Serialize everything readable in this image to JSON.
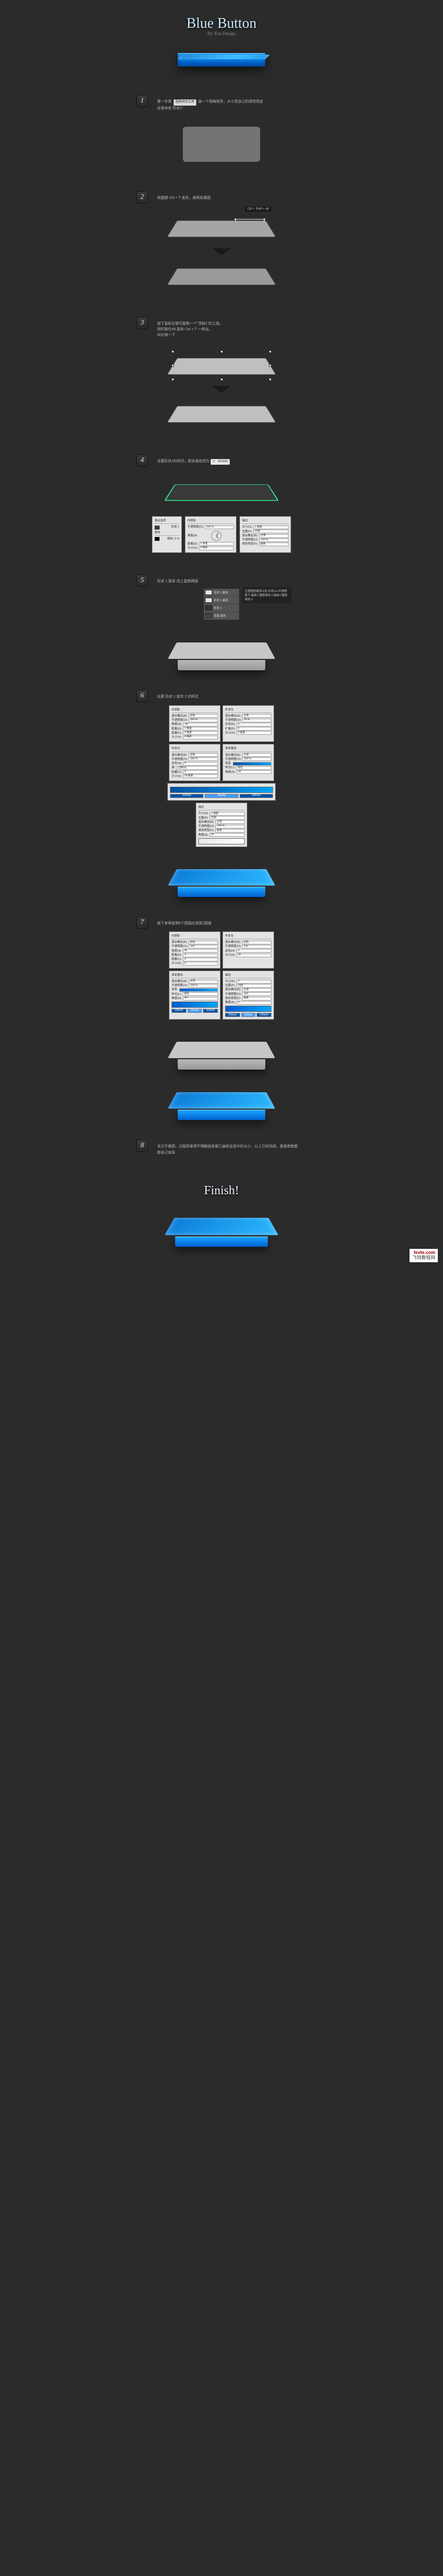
{
  "header": {
    "title": "Blue Button",
    "subtitle": "By You Design"
  },
  "steps": {
    "s1": {
      "num": "1",
      "line1_a": "第一步用",
      "tool_chip": "圆角矩形工具",
      "line1_b": "画一个圆角矩形，大小凭自己的感觉而定",
      "line2": "这里命名\"形状1\""
    },
    "s2": {
      "num": "2",
      "text": "快捷键 Ctrl + T 变形，按照效果图",
      "drag_hint": "Ctrl + Shift + Alt"
    },
    "s3": {
      "num": "3",
      "line1": "按下鼠标左键可复制一个\"顶部1\"的上面，",
      "line2": "同时按住Alt 副本 Ctrl + T 一样向，",
      "line3": "向右缩一下"
    },
    "s4": {
      "num": "4",
      "text_a": "设置形状1的样式，颜色填色改为",
      "hex": "#：393939",
      "dlg_inner": {
        "hdr": "内阴影",
        "blend": "不透明度(O):",
        "v100": "100 %",
        "angle": "角度(A):",
        "d": "距离(D):",
        "v0": "0 像素",
        "size": "大小(S):",
        "v5": "5 像素"
      },
      "dlg_stroke": {
        "hdr": "描边",
        "size": "大小(S):",
        "v1": "1 像素",
        "pos": "位置(P):",
        "outside": "外部",
        "blend": "混合模式(B):",
        "normal": "正常",
        "opacity": "不透明度(O):",
        "fill": "填充类型(F):",
        "color": "颜色"
      },
      "dlg_side1": {
        "hdr": "混合选项",
        "label": "形状 1"
      },
      "dlg_side2": {
        "hdr": "填充",
        "label": "填充: 0 %"
      }
    },
    "s5": {
      "num": "5",
      "text": "形状 1 副本 向上复制两层",
      "layers": {
        "a": "形状 1 副本",
        "b": "形状 1 副本",
        "c": "形状 1",
        "d": "背景  副本"
      },
      "note": "注意图层顺序以及\n形状1x1不透明度下\n副本1 图层填充 0\n副本2 图层填充 0"
    },
    "s6": {
      "num": "6",
      "text": "设置 形状 1 副本 2 的样式",
      "dlg_inner": {
        "hdr": "内阴影",
        "blend": "混合模式(B):",
        "scr": "滤色",
        "opacity": "不透明度(O):",
        "v100": "100 %",
        "angle": "角度(A):",
        "v90": "-90",
        "dist": "距离(D):",
        "v1": "1 像素",
        "choke": "阻塞(C):",
        "size": "大小(S):",
        "v0": "0 像素"
      },
      "dlg_outer": {
        "hdr": "外发光",
        "blend": "混合模式(B):",
        "normal": "正常",
        "opacity": "不透明度(O):",
        "v75": "75 %",
        "noise": "杂色(N):",
        "spread": "扩展(P):",
        "size": "大小(S):",
        "v5": "5 像素"
      },
      "dlg_innerglow": {
        "hdr": "内发光",
        "blend": "混合模式(B):",
        "scr": "滤色",
        "opacity": "不透明度(O):",
        "v100": "100 %",
        "noise": "杂色(N):",
        "src": "源:",
        "center": "居中(E)",
        "edge": "边缘(G)",
        "choke": "阻塞(C):",
        "size": "大小(S):",
        "v18": "18 像素"
      },
      "dlg_grad": {
        "hdr": "渐变叠加",
        "blend": "混合模式(B):",
        "normal": "正常",
        "opacity": "不透明度(O):",
        "v100": "100 %",
        "grad": "渐变:",
        "style": "样式(L):",
        "linear": "线性",
        "angle": "角度(N):",
        "v90": "90",
        "scale": "缩放(S):"
      },
      "chips": {
        "c1": "0050a3",
        "c2": "00a4fa",
        "c3": "0050a3"
      },
      "dlg_stroke": {
        "hdr": "描边",
        "size": "大小(S):",
        "v1": "1 像素",
        "pos": "位置(P):",
        "outside": "外部",
        "blend": "混合模式(B):",
        "normal": "正常",
        "opacity": "不透明度(O):",
        "v100": "100 %",
        "fill": "填充类型(F):",
        "gradient": "渐变",
        "angle": "角度(A):",
        "v90": "90"
      }
    },
    "s7": {
      "num": "7",
      "text": "接下来再复制6个图层应用到1图层",
      "dlg_inner": {
        "hdr": "内阴影",
        "blend": "混合模式(B):",
        "scr": "滤色",
        "opacity": "不透明度(O):",
        "v100": "100",
        "angle": "角度(A):",
        "v90": "90",
        "dist": "距离(D):",
        "v1": "1",
        "choke": "阻塞(C):",
        "v0": "0",
        "size": "大小(S):",
        "vs": "0"
      },
      "dlg_outer": {
        "hdr": "外发光",
        "blend": "混合模式(B):",
        "scr": "滤色",
        "opacity": "不透明度(O):",
        "v100": "100",
        "noise": "杂色(N):",
        "v0": "0",
        "source": "源",
        "spread": "扩展",
        "size": "大小(S):",
        "v10": "10"
      },
      "dlg_grad": {
        "hdr": "渐变叠加",
        "blend": "混合模式(B):",
        "normal": "正常",
        "opacity": "不透明度(O):",
        "v100": "100 %",
        "grad": "渐变:",
        "style": "样式(L):",
        "linear": "线性",
        "angle": "角度(N):",
        "v90": "90",
        "scale": "缩放(S):"
      },
      "dlg_stroke": {
        "hdr": "描边",
        "size": "大小(S):",
        "v3": "3",
        "pos": "位置(P):",
        "inside": "内部",
        "blend": "混合模式(B):",
        "normal": "正常",
        "opacity": "不透明度(O):",
        "v100": "100",
        "fill": "填充类型(F):",
        "grad": "渐变",
        "angle": "角度(A):",
        "v0": "0"
      },
      "chips": {
        "c1": "005bd3",
        "c2": "00a4fa",
        "c3": "005bd3"
      }
    },
    "s8": {
      "num": "8",
      "text": "本次不做图，过程简单得不理解就多做几遍体会其中的大小，以上已经完成，里面参数都能自己发挥"
    }
  },
  "finish": {
    "label": "Finish!"
  },
  "watermark": {
    "domain": "fevte.com",
    "cn": "飞特教程网"
  }
}
